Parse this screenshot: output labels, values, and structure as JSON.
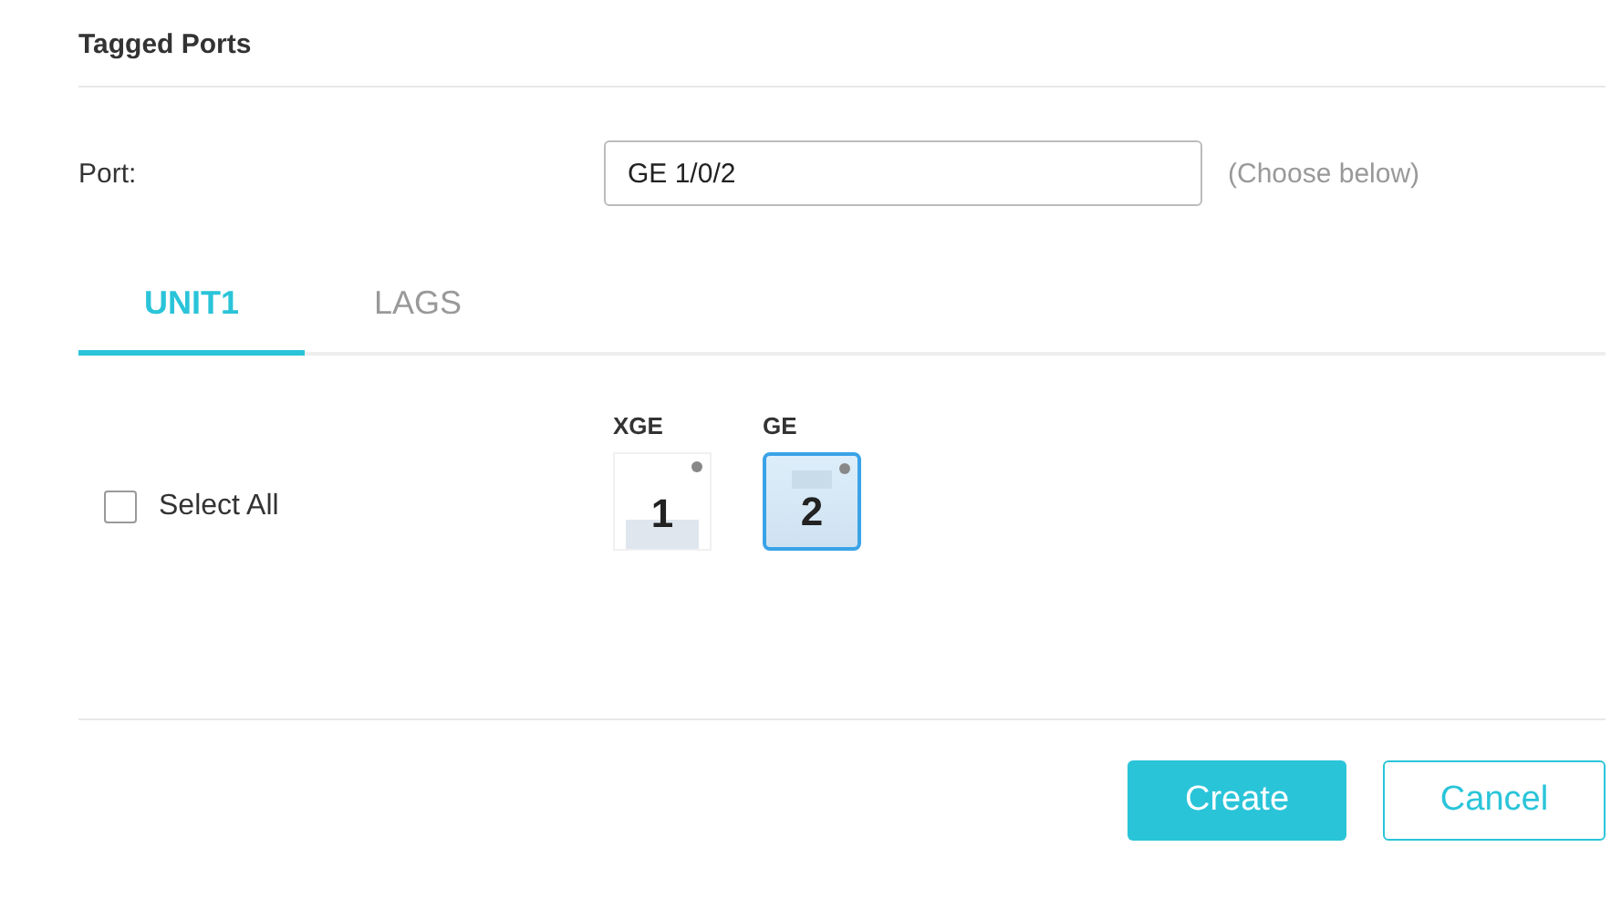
{
  "section_title": "Tagged Ports",
  "port_field": {
    "label": "Port:",
    "value": "GE 1/0/2",
    "hint": "(Choose below)"
  },
  "tabs": [
    {
      "label": "UNIT1",
      "selected": true
    },
    {
      "label": "LAGS",
      "selected": false
    }
  ],
  "select_all": {
    "label": "Select All",
    "checked": false
  },
  "port_groups": [
    {
      "label": "XGE",
      "ports": [
        {
          "label": "1",
          "selected": false
        }
      ]
    },
    {
      "label": "GE",
      "ports": [
        {
          "label": "2",
          "selected": true
        }
      ]
    }
  ],
  "buttons": [
    {
      "label": "Create",
      "kind": "primary"
    },
    {
      "label": "Cancel",
      "kind": "secondary"
    }
  ]
}
